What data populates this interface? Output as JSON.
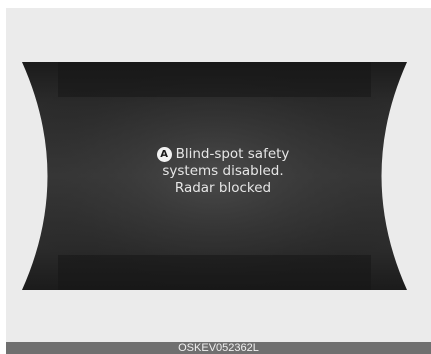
{
  "display": {
    "badge": "A",
    "message_lines": [
      "Blind-spot safety",
      "systems disabled.",
      "Radar blocked"
    ],
    "colors": {
      "panel": "#1e1e1e",
      "center": "#4a4a4a",
      "text": "#e6e6e6",
      "page": "#ebebeb"
    }
  },
  "caption": {
    "code": "OSKEV052362L"
  }
}
